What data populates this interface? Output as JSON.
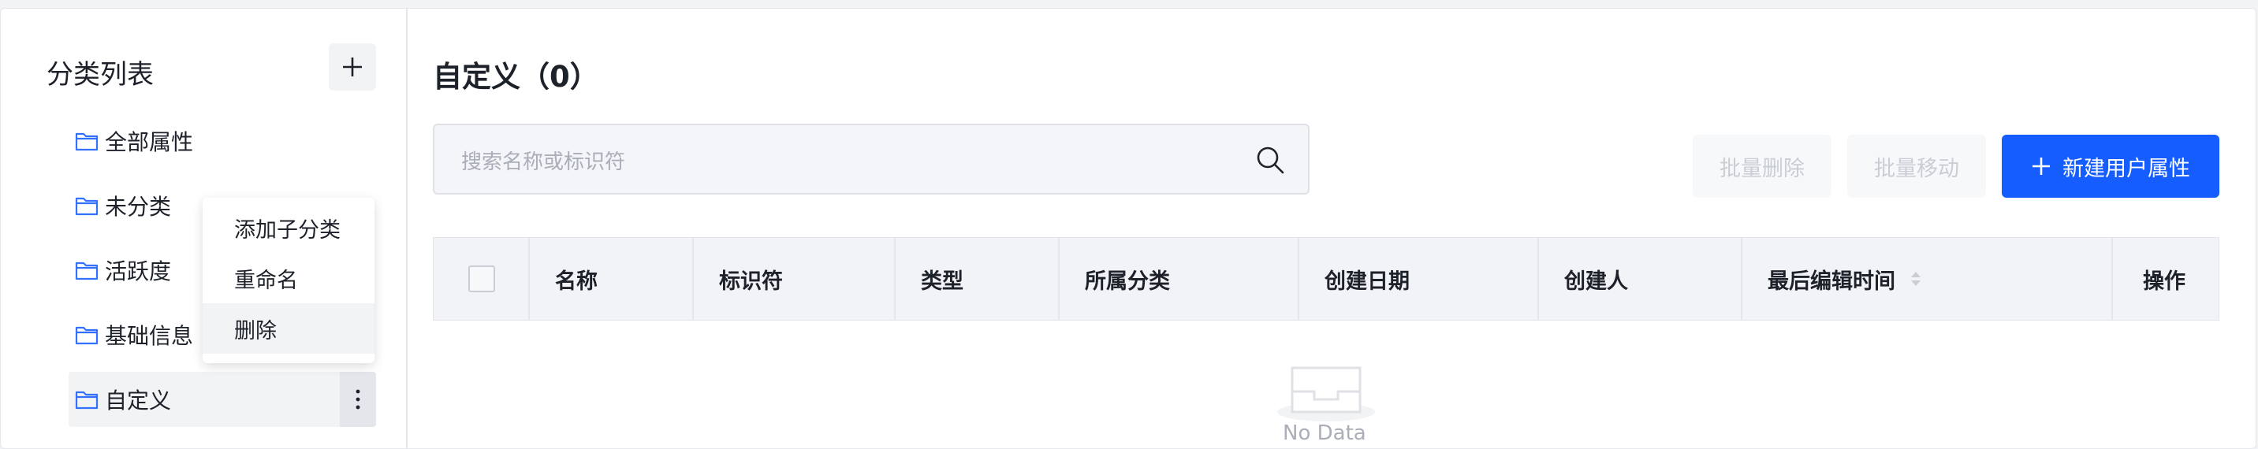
{
  "sidebar": {
    "title": "分类列表",
    "items": [
      {
        "label": "全部属性"
      },
      {
        "label": "未分类"
      },
      {
        "label": "活跃度"
      },
      {
        "label": "基础信息"
      },
      {
        "label": "自定义"
      }
    ],
    "context_menu": [
      "添加子分类",
      "重命名",
      "删除"
    ]
  },
  "main": {
    "title": "自定义（0）",
    "search_placeholder": "搜索名称或标识符",
    "buttons": {
      "batch_delete": "批量删除",
      "batch_move": "批量移动",
      "new_attribute": "新建用户属性"
    },
    "columns": [
      "名称",
      "标识符",
      "类型",
      "所属分类",
      "创建日期",
      "创建人",
      "最后编辑时间",
      "操作"
    ],
    "empty_text": "No Data"
  },
  "colors": {
    "primary": "#165dff",
    "folder_icon": "#3370ff"
  }
}
